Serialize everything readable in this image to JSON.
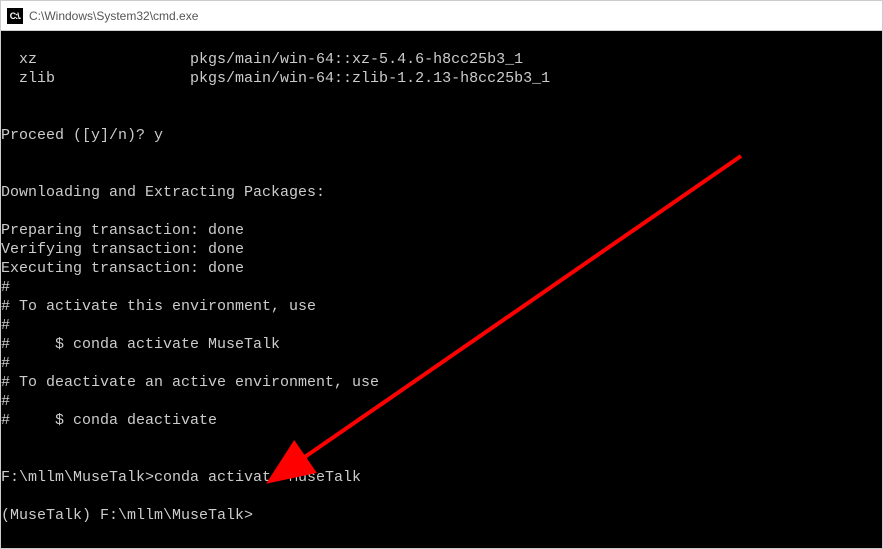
{
  "titlebar": {
    "icon_text": "C:\\.",
    "title": "C:\\Windows\\System32\\cmd.exe"
  },
  "terminal": {
    "line1": "  xz                 pkgs/main/win-64::xz-5.4.6-h8cc25b3_1",
    "line2": "  zlib               pkgs/main/win-64::zlib-1.2.13-h8cc25b3_1",
    "line3": "",
    "line4": "",
    "line5": "Proceed ([y]/n)? y",
    "line6": "",
    "line7": "",
    "line8": "Downloading and Extracting Packages:",
    "line9": "",
    "line10": "Preparing transaction: done",
    "line11": "Verifying transaction: done",
    "line12": "Executing transaction: done",
    "line13": "#",
    "line14": "# To activate this environment, use",
    "line15": "#",
    "line16": "#     $ conda activate MuseTalk",
    "line17": "#",
    "line18": "# To deactivate an active environment, use",
    "line19": "#",
    "line20": "#     $ conda deactivate",
    "line21": "",
    "line22": "",
    "line23": "F:\\mllm\\MuseTalk>conda activate MuseTalk",
    "line24": "",
    "line25": "(MuseTalk) F:\\mllm\\MuseTalk>"
  }
}
